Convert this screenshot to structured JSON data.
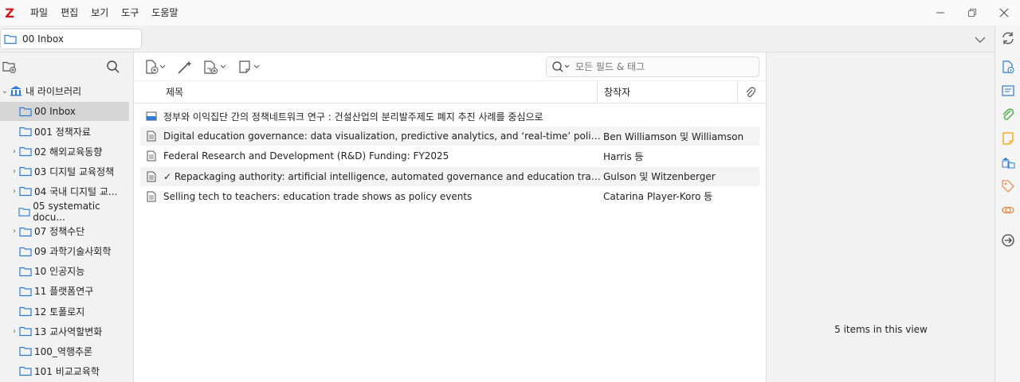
{
  "app": {
    "logo": "Z"
  },
  "menu": [
    "파일",
    "편집",
    "보기",
    "도구",
    "도움말"
  ],
  "tab": {
    "label": "00 Inbox"
  },
  "sidebar": {
    "library_label": "내 라이브러리",
    "collections": [
      {
        "label": "00 Inbox",
        "expandable": false,
        "selected": true
      },
      {
        "label": "001 정책자료",
        "expandable": false
      },
      {
        "label": "02 해외교육동향",
        "expandable": true
      },
      {
        "label": "03 디지털 교육정책",
        "expandable": true
      },
      {
        "label": "04 국내 디지털 교...",
        "expandable": true
      },
      {
        "label": "05 systematic docu...",
        "expandable": false
      },
      {
        "label": "07 정책수단",
        "expandable": true
      },
      {
        "label": "09 과학기술사회학",
        "expandable": false
      },
      {
        "label": "10 인공지능",
        "expandable": false
      },
      {
        "label": "11 플랫폼연구",
        "expandable": false
      },
      {
        "label": "12 토폴로지",
        "expandable": false
      },
      {
        "label": "13 교사역할변화",
        "expandable": true
      },
      {
        "label": "100_역행추론",
        "expandable": false
      },
      {
        "label": "101 비교교육학",
        "expandable": false
      }
    ]
  },
  "search": {
    "placeholder": "모든 필드 & 태그"
  },
  "columns": {
    "title": "제목",
    "creator": "창작자"
  },
  "items": [
    {
      "icon": "report-icon",
      "title": "정부와 이익집단 간의 정책네트워크 연구 : 건설산업의 분리발주제도 폐지 추진 사례를 중심으로",
      "creator": ""
    },
    {
      "icon": "document-icon",
      "title": "Digital education governance: data visualization, predictive analytics, and ‘real-time’ policy instrum...",
      "creator": "Ben Williamson 및 Williamson"
    },
    {
      "icon": "document-icon",
      "title": "Federal Research and Development (R&D) Funding: FY2025",
      "creator": "Harris 등"
    },
    {
      "icon": "document-icon",
      "title": "✓ Repackaging authority: artificial intelligence, automated governance and education trade shows",
      "creator": "Gulson 및 Witzenberger"
    },
    {
      "icon": "document-icon",
      "title": "Selling tech to teachers: education trade shows as policy events",
      "creator": "Catarina Player-Koro 등"
    }
  ],
  "right_pane": {
    "count_text": "5 items in this view"
  },
  "colors": {
    "accent": "#2e7bd6",
    "logo": "#d7191c",
    "selected": "#d6d6d6"
  }
}
